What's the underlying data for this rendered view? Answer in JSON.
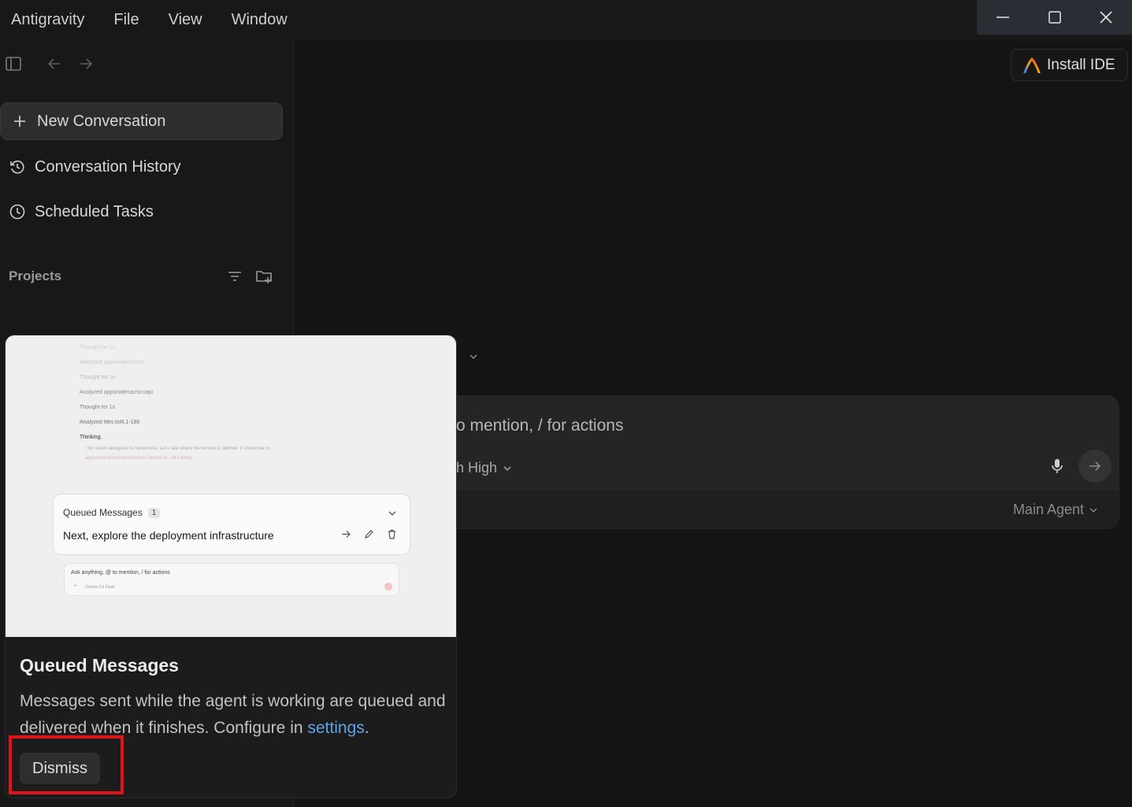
{
  "menu": {
    "app": "Antigravity",
    "items": [
      "File",
      "View",
      "Window"
    ]
  },
  "sidebar": {
    "new_conversation": "New Conversation",
    "conversation_history": "Conversation History",
    "scheduled_tasks": "Scheduled Tasks",
    "projects_label": "Projects"
  },
  "header": {
    "install_ide": "Install IDE"
  },
  "composer": {
    "placeholder_visible": "o mention, / for actions",
    "model_visible": "h High",
    "agent": "Main Agent"
  },
  "popup": {
    "preview": {
      "lines": [
        "Thought for 1s",
        "Analyzed  apps/sidecar/src",
        "Thought for 1s",
        "Analyzed  apps/sidecar/src/api",
        "Thought for 1s",
        "Analyzed  files.ts#L1-186",
        "Thinking.",
        "The router delegates to fileService. Let's see where fileService is defined. It should be in",
        "apps/sidecar/src/services/file-service.ts. Let's verify"
      ],
      "queue_title": "Queued Messages",
      "queue_count": "1",
      "queue_item": "Next, explore the deployment infrastructure",
      "mini_placeholder": "Ask anything, @ to mention, / for actions",
      "mini_model": "Gemini 3.5 Flash"
    },
    "title": "Queued Messages",
    "description": "Messages sent while the agent is working are queued and delivered when it finishes. Configure in ",
    "settings_link": "settings",
    "description_end": ".",
    "dismiss": "Dismiss"
  },
  "colors": {
    "background": "#141414",
    "sidebar": "#181818",
    "link": "#5ea4e6",
    "highlight": "#e1141b"
  }
}
